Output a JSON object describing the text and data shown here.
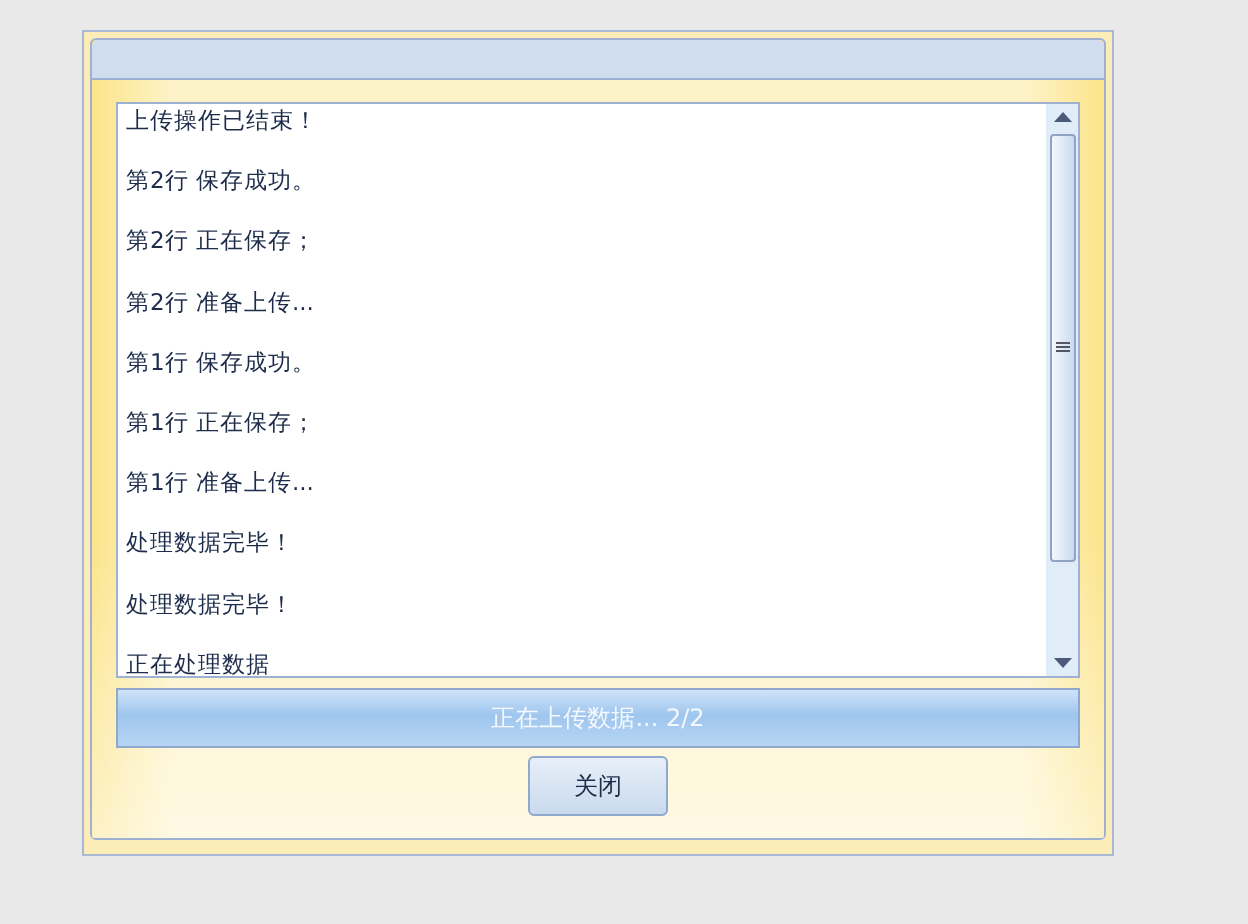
{
  "log": {
    "lines": [
      "上传操作已结束！",
      "第2行 保存成功。",
      "第2行 正在保存；",
      "第2行 准备上传...",
      "第1行 保存成功。",
      "第1行 正在保存；",
      "第1行 准备上传...",
      "处理数据完毕！",
      "处理数据完毕！",
      "正在处理数据"
    ]
  },
  "progress": {
    "label": "正在上传数据... 2/2",
    "level": 1
  },
  "buttons": [
    {
      "label": "关闭"
    }
  ]
}
